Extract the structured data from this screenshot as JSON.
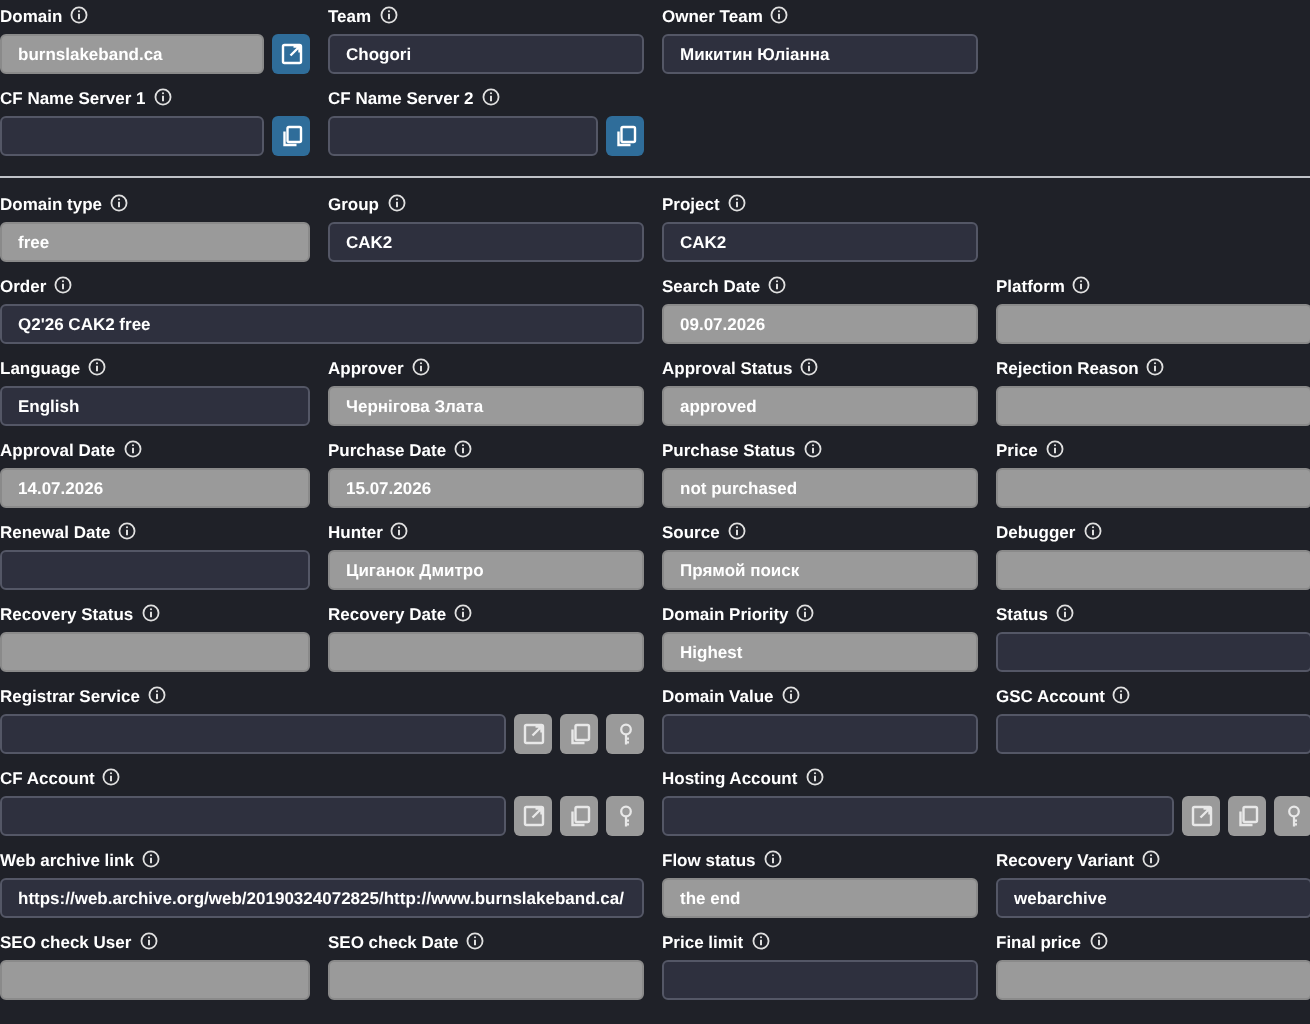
{
  "sections": [
    {
      "rows": [
        [
          {
            "label": "Domain",
            "value": "burnslakeband.ca",
            "disabled": true,
            "wide": false,
            "buttons": [
              {
                "kind": "external-link",
                "disabled": false
              }
            ]
          },
          {
            "label": "Team",
            "value": "Chogori",
            "disabled": false,
            "wide": false
          },
          {
            "label": "Owner Team",
            "value": "Микитин Юліанна",
            "disabled": false,
            "wide": false
          }
        ],
        [
          {
            "label": "CF Name Server 1",
            "disabled": false,
            "wide": false,
            "buttons": [
              {
                "kind": "copy",
                "disabled": false
              }
            ]
          },
          {
            "label": "CF Name Server 2",
            "disabled": false,
            "wide": false,
            "buttons": [
              {
                "kind": "copy",
                "disabled": false
              }
            ]
          }
        ]
      ]
    },
    {
      "rows": [
        [
          {
            "label": "Domain type",
            "value": "free",
            "disabled": true,
            "wide": false
          },
          {
            "label": "Group",
            "value": "CAK2",
            "disabled": false,
            "wide": false
          },
          {
            "label": "Project",
            "value": "CAK2",
            "disabled": false,
            "wide": false
          }
        ],
        [
          {
            "label": "Order",
            "value": "Q2'26 CAK2 free",
            "disabled": false,
            "wide": true
          },
          {
            "label": "Search Date",
            "value": "09.07.2026",
            "disabled": true,
            "wide": false
          },
          {
            "label": "Platform",
            "disabled": true,
            "wide": false
          }
        ],
        [
          {
            "label": "Language",
            "value": "English",
            "disabled": false,
            "wide": false
          },
          {
            "label": "Approver",
            "value": "Чернігова Злата",
            "disabled": true,
            "wide": false
          },
          {
            "label": "Approval Status",
            "value": "approved",
            "disabled": true,
            "wide": false
          },
          {
            "label": "Rejection Reason",
            "disabled": true,
            "wide": false
          }
        ],
        [
          {
            "label": "Approval Date",
            "value": "14.07.2026",
            "disabled": true,
            "wide": false
          },
          {
            "label": "Purchase Date",
            "value": "15.07.2026",
            "disabled": true,
            "wide": false
          },
          {
            "label": "Purchase Status",
            "value": "not purchased",
            "disabled": true,
            "wide": false
          },
          {
            "label": "Price",
            "disabled": true,
            "wide": false
          }
        ],
        [
          {
            "label": "Renewal Date",
            "disabled": false,
            "wide": false
          },
          {
            "label": "Hunter",
            "value": "Циганок Дмитро",
            "disabled": true,
            "wide": false
          },
          {
            "label": "Source",
            "value": "Прямой поиск",
            "disabled": true,
            "wide": false
          },
          {
            "label": "Debugger",
            "disabled": true,
            "wide": false
          }
        ],
        [
          {
            "label": "Recovery Status",
            "disabled": true,
            "wide": false
          },
          {
            "label": "Recovery Date",
            "disabled": true,
            "wide": false
          },
          {
            "label": "Domain Priority",
            "value": "Highest",
            "disabled": true,
            "wide": false
          },
          {
            "label": "Status",
            "disabled": false,
            "wide": false
          }
        ],
        [
          {
            "label": "Registrar Service",
            "disabled": false,
            "wide": true,
            "buttons": [
              {
                "kind": "external-link",
                "disabled": true
              },
              {
                "kind": "copy",
                "disabled": true
              },
              {
                "kind": "key",
                "disabled": true
              }
            ]
          },
          {
            "label": "Domain Value",
            "disabled": false,
            "wide": false
          },
          {
            "label": "GSC Account",
            "disabled": false,
            "wide": false
          }
        ],
        [
          {
            "label": "CF Account",
            "disabled": false,
            "wide": true,
            "buttons": [
              {
                "kind": "external-link",
                "disabled": true
              },
              {
                "kind": "copy",
                "disabled": true
              },
              {
                "kind": "key",
                "disabled": true
              }
            ]
          },
          {
            "label": "Hosting Account",
            "disabled": false,
            "wide": true,
            "buttons": [
              {
                "kind": "external-link",
                "disabled": true
              },
              {
                "kind": "copy",
                "disabled": true
              },
              {
                "kind": "key",
                "disabled": true
              }
            ]
          }
        ],
        [
          {
            "label": "Web archive link",
            "value": "https://web.archive.org/web/20190324072825/http://www.burnslakeband.ca/",
            "disabled": false,
            "wide": true
          },
          {
            "label": "Flow status",
            "value": "the end",
            "disabled": true,
            "wide": false
          },
          {
            "label": "Recovery Variant",
            "value": "webarchive",
            "disabled": false,
            "wide": false
          }
        ],
        [
          {
            "label": "SEO check User",
            "disabled": true,
            "wide": false
          },
          {
            "label": "SEO check Date",
            "disabled": true,
            "wide": false
          },
          {
            "label": "Price limit",
            "disabled": false,
            "wide": false
          },
          {
            "label": "Final price",
            "disabled": true,
            "wide": false
          }
        ]
      ]
    }
  ]
}
